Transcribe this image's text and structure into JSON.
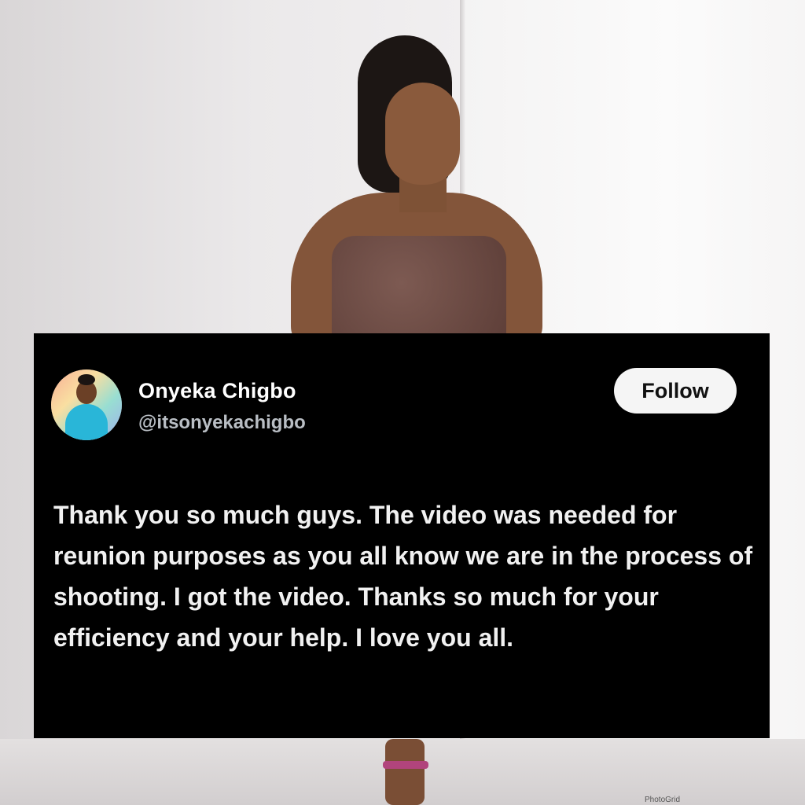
{
  "tweet": {
    "display_name": "Onyeka Chigbo",
    "handle": "@itsonyekachigbo",
    "follow_label": "Follow",
    "text": "Thank you so much guys. The video was needed for reunion purposes as you all know we are in the process of shooting. I got the video. Thanks so much for your efficiency and your help. I love you all."
  },
  "overlay": {
    "watermark": "PhotoGrid"
  },
  "colors": {
    "card_background": "#000000",
    "button_background": "#f5f5f5",
    "handle_text": "#b9bec4"
  },
  "icons": {
    "avatar": "profile-photo"
  }
}
